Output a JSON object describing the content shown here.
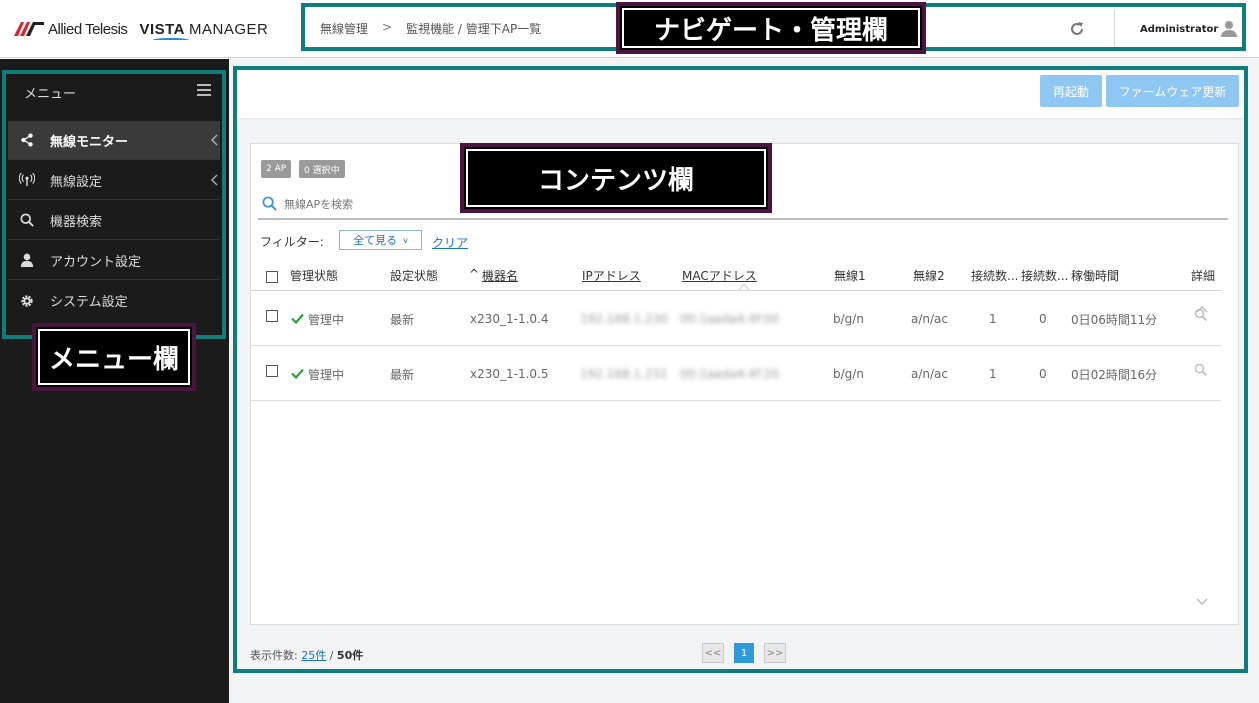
{
  "header": {
    "brand": "Allied Telesis",
    "product_vista": "VISTA",
    "product_manager": "MANAGER",
    "breadcrumb": [
      "無線管理",
      "監視機能 / 管理下AP一覧"
    ],
    "breadcrumb_sep": ">",
    "user": "Administrator",
    "icons": [
      "refresh-icon",
      "user-icon"
    ]
  },
  "annotations": {
    "nav": "ナビゲート・管理欄",
    "content": "コンテンツ欄",
    "menu": "メニュー欄",
    "frame_color": "#0e7d7b"
  },
  "sidebar": {
    "title": "メニュー",
    "items": [
      {
        "label": "無線モニター",
        "icon": "share-icon",
        "active": true
      },
      {
        "label": "無線設定",
        "icon": "antenna-icon"
      },
      {
        "label": "機器検索",
        "icon": "search-icon"
      },
      {
        "label": "アカウント設定",
        "icon": "user-icon"
      },
      {
        "label": "システム設定",
        "icon": "gear-icon"
      }
    ]
  },
  "toolbar": {
    "restart": "再起動",
    "firmware": "ファームウェア更新",
    "button_color": "#8fc7f3"
  },
  "list": {
    "badge_ap": "2 AP",
    "badge_selected": "0 選択中",
    "search_placeholder": "無線APを検索",
    "filter_label": "フィルター:",
    "filter_value": "全て見る",
    "clear": "クリア",
    "sort_indicator": "^",
    "columns": [
      "管理状態",
      "設定状態",
      "機器名",
      "IPアドレス",
      "MACアドレス",
      "無線1",
      "無線2",
      "接続数...",
      "接続数...",
      "稼働時間",
      "詳細"
    ],
    "rows": [
      {
        "status": "管理中",
        "config": "最新",
        "name": "x230_1-1.0.4",
        "ip": "192.168.1.230",
        "mac": "00:1aada4:4f:00",
        "radio1": "b/g/n",
        "radio2": "a/n/ac",
        "conn1": "1",
        "conn2": "0",
        "uptime": "0日06時間11分"
      },
      {
        "status": "管理中",
        "config": "最新",
        "name": "x230_1-1.0.5",
        "ip": "192.168.1.231",
        "mac": "00:1aada4:4f:20",
        "radio1": "b/g/n",
        "radio2": "a/n/ac",
        "conn1": "1",
        "conn2": "0",
        "uptime": "0日02時間16分"
      }
    ],
    "status_color": "#2aa33a"
  },
  "footer": {
    "count_label": "表示件数:",
    "per_page": "25件",
    "total": "50件",
    "pager_prev": "<<",
    "pager_current": "1",
    "pager_next": ">>"
  }
}
